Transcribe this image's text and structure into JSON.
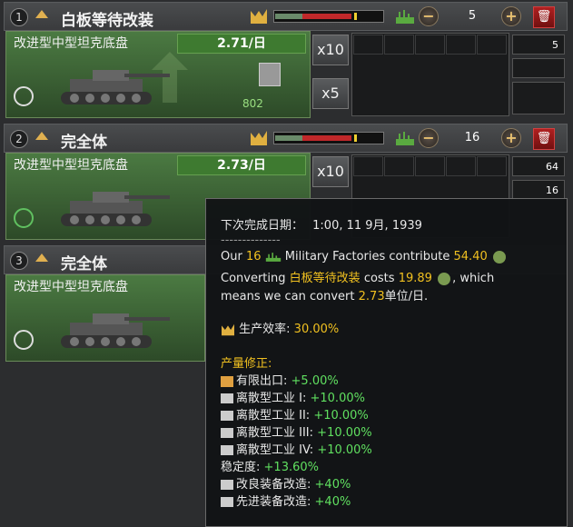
{
  "rows": [
    {
      "number": "1",
      "title": "白板等待改装",
      "equipment": "改进型中型坦克底盘",
      "rate": "2.71/日",
      "factories": "5",
      "stockpile": "802",
      "side_value": "5",
      "multipliers": [
        "x10",
        "x5"
      ]
    },
    {
      "number": "2",
      "title": "完全体",
      "equipment": "改进型中型坦克底盘",
      "rate": "2.73/日",
      "factories": "16",
      "side_value_1": "64",
      "side_value_2": "16",
      "multipliers": [
        "x10"
      ]
    },
    {
      "number": "3",
      "title": "完全体",
      "equipment": "改进型中型坦克底盘"
    }
  ],
  "tooltip": {
    "completion_label": "下次完成日期：",
    "completion_date": "1:00, 11 9月, 1939",
    "separator": "--------------",
    "our": "Our",
    "factory_count": "16",
    "contribute": "Military Factories contribute",
    "ic_value": "54.40",
    "converting": "Converting",
    "converting_name": "白板等待改装",
    "costs": "costs",
    "cost_value": "19.89",
    "which": ", which",
    "means": "means we can convert",
    "convert_value": "2.73",
    "unit": "单位/日.",
    "efficiency_label": "生产效率:",
    "efficiency_value": "30.00%",
    "modifiers_header": "产量修正:",
    "modifiers": [
      {
        "icon": "temple-icon",
        "label": "有限出口:",
        "value": "+5.00%"
      },
      {
        "icon": "book-icon",
        "label": "离散型工业 I:",
        "value": "+10.00%"
      },
      {
        "icon": "book-icon",
        "label": "离散型工业 II:",
        "value": "+10.00%"
      },
      {
        "icon": "book-icon",
        "label": "离散型工业 III:",
        "value": "+10.00%"
      },
      {
        "icon": "book-icon",
        "label": "离散型工业 IV:",
        "value": "+10.00%"
      },
      {
        "icon": "",
        "label": "稳定度:",
        "value": "+13.60%"
      },
      {
        "icon": "book-icon",
        "label": "改良装备改造:",
        "value": "+40%"
      },
      {
        "icon": "book-icon",
        "label": "先进装备改造:",
        "value": "+40%"
      }
    ]
  },
  "colors": {
    "accent": "#f0c020",
    "positive": "#60e060",
    "body_green": "#4b7a42",
    "delete_red": "#b02020"
  }
}
